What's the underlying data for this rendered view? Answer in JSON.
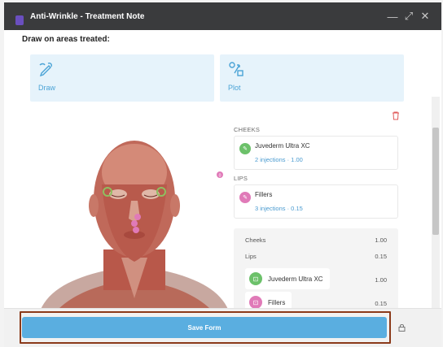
{
  "window": {
    "title": "Anti-Wrinkle - Treatment Note",
    "controls": {
      "minimize": "—",
      "maximize": "⤢",
      "close": "✕"
    }
  },
  "form": {
    "section_title": "Draw on areas treated:",
    "tiles": [
      {
        "label": "Draw",
        "icon": "draw-icon"
      },
      {
        "label": "Plot",
        "icon": "plot-icon"
      }
    ],
    "delete_icon": "trash-icon",
    "marker_count": "0"
  },
  "treatments": [
    {
      "area": "CHEEKS",
      "product": "Juvederm Ultra XC",
      "summary": "2 injections · 1.00",
      "color": "#6cc16a"
    },
    {
      "area": "LIPS",
      "product": "Fillers",
      "summary": "3 injections · 0.15",
      "color": "#e07ab8"
    }
  ],
  "summary": {
    "rows": [
      {
        "label": "Cheeks",
        "value": "1.00"
      },
      {
        "label": "Lips",
        "value": "0.15"
      }
    ],
    "products": [
      {
        "name": "Juvederm Ultra XC",
        "value": "1.00",
        "color": "#6cc16a"
      },
      {
        "name": "Fillers",
        "value": "0.15",
        "color": "#e07ab8"
      }
    ]
  },
  "footer": {
    "save_label": "Save Form",
    "lock_icon": "lock-icon"
  },
  "colors": {
    "accent": "#5aaee0",
    "titlebar": "#3a3b3d",
    "tile_bg": "#e6f3fb"
  }
}
